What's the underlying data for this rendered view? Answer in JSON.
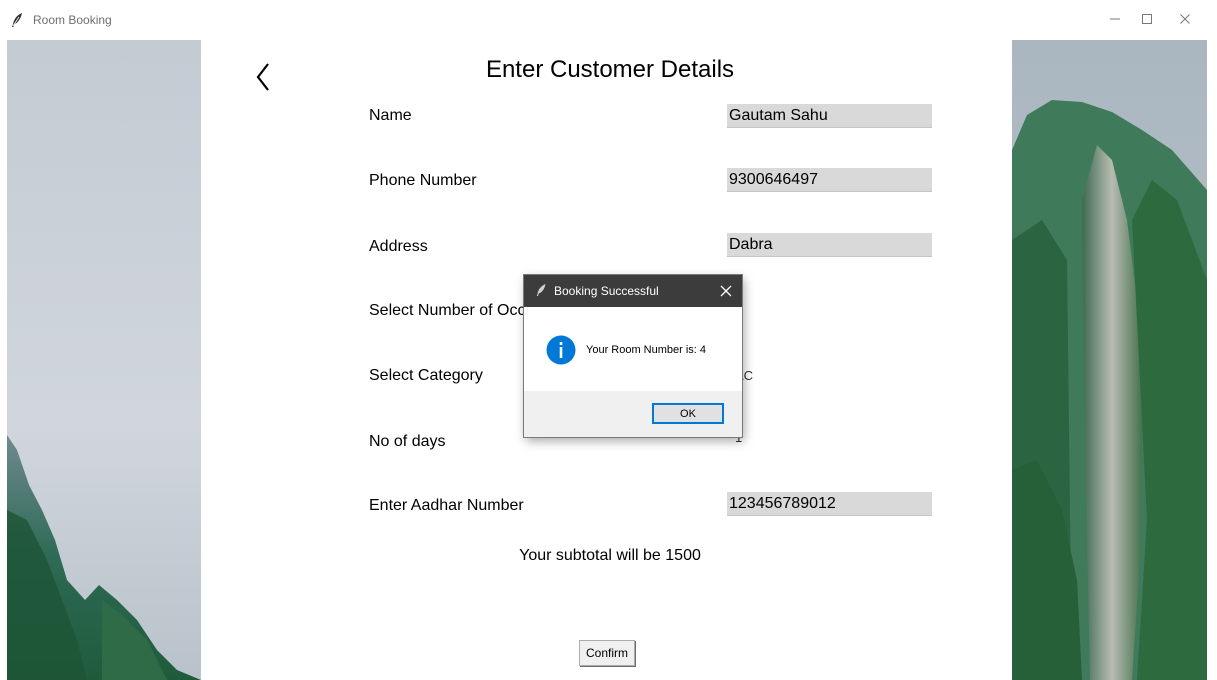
{
  "window": {
    "title": "Room Booking",
    "icon": "feather-icon"
  },
  "form": {
    "heading": "Enter Customer Details",
    "fields": [
      {
        "label": "Name",
        "value": "Gautam Sahu"
      },
      {
        "label": "Phone Number",
        "value": "9300646497"
      },
      {
        "label": "Address",
        "value": "Dabra"
      },
      {
        "label": "Select Number of Occupants",
        "value": ""
      },
      {
        "label": "Select Category",
        "value": "AC"
      },
      {
        "label": "No of days",
        "value": "1"
      },
      {
        "label": "Enter Aadhar Number",
        "value": "123456789012"
      }
    ],
    "subtotal_text": "Your subtotal will be 1500",
    "confirm_label": "Confirm"
  },
  "dialog": {
    "title": "Booking Successful",
    "message": "Your Room Number is: 4",
    "ok_label": "OK",
    "icon": "info-icon"
  },
  "colors": {
    "field_bg": "#d9d9d9",
    "dialog_titlebar": "#3c3c3c",
    "info_blue": "#0078d7"
  }
}
